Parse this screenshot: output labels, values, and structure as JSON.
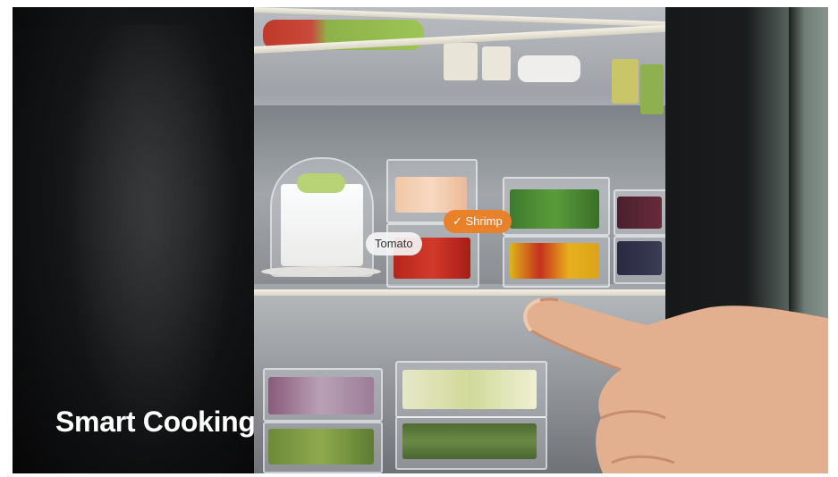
{
  "video": {
    "caption": "Smart Cooking"
  },
  "screen": {
    "tags": [
      {
        "label": "Tomato",
        "selected": false
      },
      {
        "label": "Shrimp",
        "selected": true,
        "check": "✓"
      }
    ]
  },
  "colors": {
    "accent": "#e8812a",
    "tag_bg": "#f2f2f2",
    "caption": "#ffffff"
  }
}
